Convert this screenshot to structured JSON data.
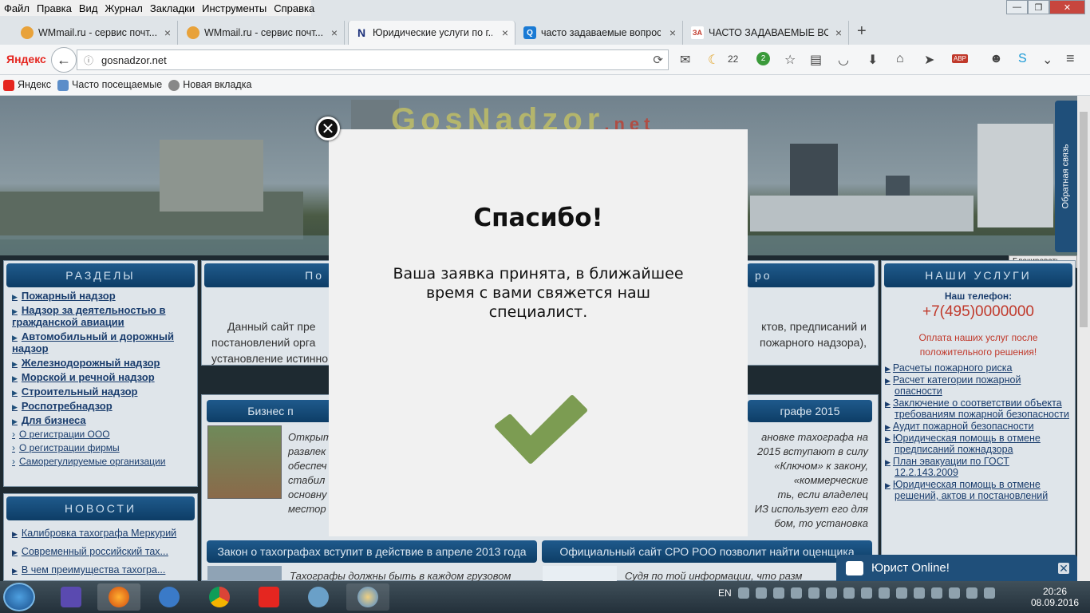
{
  "menu": [
    "Файл",
    "Правка",
    "Вид",
    "Журнал",
    "Закладки",
    "Инструменты",
    "Справка"
  ],
  "window_controls": {
    "minimize": "—",
    "maximize": "❐",
    "close": "✕"
  },
  "tabs": [
    {
      "title": "WMmail.ru - сервис почт...",
      "icon": "wmmail-icon",
      "color": "#e8a23a"
    },
    {
      "title": "WMmail.ru - сервис почт...",
      "icon": "wmmail-icon",
      "color": "#e8a23a"
    },
    {
      "title": "Юридические услуги по г...",
      "icon": "N",
      "color": "#1a2f7a",
      "active": true
    },
    {
      "title": "часто задаваемые вопрос...",
      "icon": "search-icon",
      "color": "#1a7ad4"
    },
    {
      "title": "ЧАСТО ЗАДАВАЕМЫЕ ВО...",
      "icon": "ЗА",
      "color": "#c0392b"
    }
  ],
  "tab_close": "×",
  "new_tab": "+",
  "navbar": {
    "yandex": "Яндекс",
    "back": "←",
    "url": "gosnadzor.net",
    "reload": "⟳",
    "moon_count": "22",
    "badge": "2",
    "abp": "ABP"
  },
  "bookmarks": [
    "Яндекс",
    "Часто посещаемые",
    "Новая вкладка"
  ],
  "site": {
    "logo_main": "GosNadzor",
    "logo_net": ".net",
    "feedback": "Обратная связь",
    "blocker": "Блокировать..."
  },
  "sections": {
    "title": "РАЗДЕЛЫ",
    "items": [
      "Пожарный надзор",
      "Надзор за деятельностью в гражданской авиации",
      "Автомобильный и дорожный надзор",
      "Железнодорожный надзор",
      "Морской и речной надзор",
      "Строительный надзор",
      "Роспотребнадзор",
      "Для бизнеса"
    ],
    "sub": [
      "О регистрации ООО",
      "О регистрации фирмы",
      "Саморегулируемые организации"
    ]
  },
  "news": {
    "title": "НОВОСТИ",
    "items": [
      "Калибровка тахографа Меркурий",
      "Современный российский тах...",
      "В чем преимущества тахогра..."
    ]
  },
  "center": {
    "bar_left": "По",
    "bar_right": "ро",
    "text_left": "Данный сайт пре",
    "text_left2": "постановлений орга",
    "text_left3": "установление истинно",
    "text_right": "ктов, предписаний и",
    "text_right2": "пожарного надзора),",
    "biz_left": "Бизнес п",
    "biz_right": "графе 2015",
    "biz_text_left": [
      "Открыт",
      "развлек",
      "обеспеч",
      "стабил",
      "основну",
      "местор"
    ],
    "biz_text_right": [
      "ановке тахографа на",
      "2015 вступают в силу",
      "«Ключом» к закону,",
      "«коммерческие",
      "ть, если владелец",
      "ИЗ использует его для",
      "бом, то установка"
    ],
    "bar_tacho": "Закон о тахографах вступит в действие в апреле 2013 года",
    "bar_sro": "Официальный сайт СРО РОО позволит найти оценщика",
    "tacho_text": "Тахографы должны быть в каждом грузовом",
    "sro_text": "Судя по той информации, что разм"
  },
  "services": {
    "title": "НАШИ УСЛУГИ",
    "phone_label": "Наш телефон:",
    "phone": "+7(495)0000000",
    "note": "Оплата наших услуг после положительного решения!",
    "items": [
      "Расчеты пожарного риска",
      "Расчет категории пожарной опасности",
      "Заключение о соответствии объекта требованиям пожарной безопасности",
      "Аудит пожарной безопасности",
      "Юридическая помощь в отмене предписаний пожнадзора",
      "План эвакуации по ГОСТ 12.2.143.2009",
      "Юридическая помощь в отмене решений, актов и постановлений"
    ]
  },
  "modal": {
    "close": "✕",
    "title": "Спасибо!",
    "message": "Ваша заявка принята, в ближайшее время с вами свяжется наш специалист.",
    "check_color": "#7c9c52"
  },
  "chat": {
    "label": "Юрист Online!",
    "close": "✕"
  },
  "taskbar": {
    "lang": "EN",
    "time": "20:26",
    "date": "08.09.2016"
  }
}
